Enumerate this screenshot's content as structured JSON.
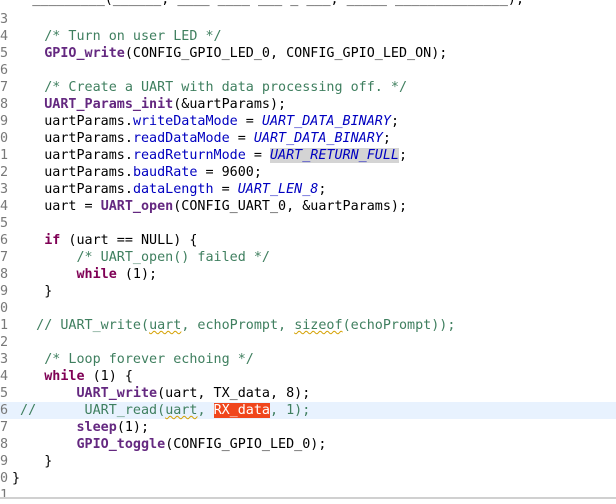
{
  "editor": {
    "top_partial_text": "    _________(______, ____ ____ ___ _ ___, _____ ______________);",
    "lines": [
      {
        "n": "3",
        "segs": []
      },
      {
        "n": "4",
        "segs": [
          {
            "c": "cm",
            "t": "    /* Turn on user LED */"
          }
        ]
      },
      {
        "n": "5",
        "segs": [
          {
            "t": "    "
          },
          {
            "c": "fn",
            "t": "GPIO_write"
          },
          {
            "t": "(CONFIG_GPIO_LED_0, CONFIG_GPIO_LED_ON);"
          }
        ]
      },
      {
        "n": "6",
        "segs": []
      },
      {
        "n": "7",
        "segs": [
          {
            "c": "cm",
            "t": "    /* Create a UART with data processing off. */"
          }
        ]
      },
      {
        "n": "8",
        "segs": [
          {
            "t": "    "
          },
          {
            "c": "fn",
            "t": "UART_Params_init"
          },
          {
            "t": "(&uartParams);"
          }
        ]
      },
      {
        "n": "9",
        "segs": [
          {
            "t": "    uartParams."
          },
          {
            "c": "fld",
            "t": "writeDataMode"
          },
          {
            "t": " = "
          },
          {
            "c": "en",
            "t": "UART_DATA_BINARY"
          },
          {
            "t": ";"
          }
        ]
      },
      {
        "n": "0",
        "segs": [
          {
            "t": "    uartParams."
          },
          {
            "c": "fld",
            "t": "readDataMode"
          },
          {
            "t": " = "
          },
          {
            "c": "en",
            "t": "UART_DATA_BINARY"
          },
          {
            "t": ";"
          }
        ]
      },
      {
        "n": "1",
        "segs": [
          {
            "t": "    uartParams."
          },
          {
            "c": "fld",
            "t": "readReturnMode"
          },
          {
            "t": " = "
          },
          {
            "c": "en hl",
            "t": "UART_RETURN_FULL"
          },
          {
            "t": ";"
          }
        ]
      },
      {
        "n": "2",
        "segs": [
          {
            "t": "    uartParams."
          },
          {
            "c": "fld",
            "t": "baudRate"
          },
          {
            "t": " = 9600;"
          }
        ]
      },
      {
        "n": "3",
        "segs": [
          {
            "t": "    uartParams."
          },
          {
            "c": "fld",
            "t": "dataLength"
          },
          {
            "t": " = "
          },
          {
            "c": "en",
            "t": "UART_LEN_8"
          },
          {
            "t": ";"
          }
        ]
      },
      {
        "n": "4",
        "segs": [
          {
            "t": "    uart = "
          },
          {
            "c": "fn",
            "t": "UART_open"
          },
          {
            "t": "(CONFIG_UART_0, &uartParams);"
          }
        ]
      },
      {
        "n": "5",
        "segs": []
      },
      {
        "n": "6",
        "segs": [
          {
            "t": "    "
          },
          {
            "c": "kw",
            "t": "if"
          },
          {
            "t": " (uart == NULL) {"
          }
        ]
      },
      {
        "n": "7",
        "segs": [
          {
            "c": "cm",
            "t": "        /* UART_open() failed */"
          }
        ]
      },
      {
        "n": "8",
        "segs": [
          {
            "t": "        "
          },
          {
            "c": "kw",
            "t": "while"
          },
          {
            "t": " (1);"
          }
        ]
      },
      {
        "n": "9",
        "segs": [
          {
            "t": "    }"
          }
        ]
      },
      {
        "n": "0",
        "segs": []
      },
      {
        "n": "1",
        "segs": [
          {
            "c": "cm",
            "t": "   // UART_write("
          },
          {
            "c": "cm sq",
            "t": "uart"
          },
          {
            "c": "cm",
            "t": ", echoPrompt, "
          },
          {
            "c": "cm sq",
            "t": "sizeof"
          },
          {
            "c": "cm",
            "t": "(echoPrompt));"
          }
        ]
      },
      {
        "n": "2",
        "segs": []
      },
      {
        "n": "3",
        "segs": [
          {
            "c": "cm",
            "t": "    /* Loop forever echoing */"
          }
        ]
      },
      {
        "n": "4",
        "segs": [
          {
            "t": "    "
          },
          {
            "c": "kw",
            "t": "while"
          },
          {
            "t": " (1) {"
          }
        ]
      },
      {
        "n": "5",
        "segs": [
          {
            "t": "        "
          },
          {
            "c": "fn",
            "t": "UART_write"
          },
          {
            "t": "(uart, TX_data, 8);"
          }
        ]
      },
      {
        "n": "6",
        "cur": true,
        "segs": [
          {
            "c": "cm",
            "t": " //      UART_read("
          },
          {
            "c": "cm sq",
            "t": "uart"
          },
          {
            "c": "cm",
            "t": ", "
          },
          {
            "c": "sel",
            "t": "RX_data"
          },
          {
            "c": "cm",
            "t": ", 1);"
          }
        ]
      },
      {
        "n": "7",
        "segs": [
          {
            "t": "        "
          },
          {
            "c": "fn",
            "t": "sleep"
          },
          {
            "t": "(1);"
          }
        ]
      },
      {
        "n": "8",
        "segs": [
          {
            "t": "        "
          },
          {
            "c": "fn",
            "t": "GPIO_toggle"
          },
          {
            "t": "(CONFIG_GPIO_LED_0);"
          }
        ]
      },
      {
        "n": "9",
        "segs": [
          {
            "t": "    }"
          }
        ]
      },
      {
        "n": "0",
        "segs": [
          {
            "t": "}"
          }
        ]
      },
      {
        "n": "1",
        "segs": []
      }
    ]
  }
}
